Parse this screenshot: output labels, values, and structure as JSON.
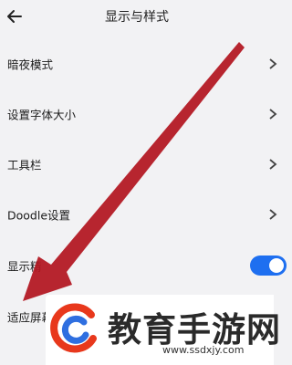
{
  "header": {
    "back_icon": "arrow-left-icon",
    "title": "显示与样式"
  },
  "settings": {
    "items": [
      {
        "label": "暗夜模式",
        "control": "chevron-right-icon"
      },
      {
        "label": "设置字体大小",
        "control": "chevron-right-icon"
      },
      {
        "label": "工具栏",
        "control": "chevron-right-icon"
      },
      {
        "label": "Doodle设置",
        "control": "chevron-right-icon"
      },
      {
        "label": "显示精",
        "control": "toggle",
        "toggle_on": true
      },
      {
        "label": "适应屏幕",
        "control": "none"
      }
    ]
  },
  "annotation": {
    "type": "arrow",
    "color": "#b3161f"
  },
  "watermark": {
    "brand": "教育手游网",
    "url": "www.ssdxjy.com",
    "logo_colors": [
      "#e8381c",
      "#2f6fe0"
    ]
  },
  "colors": {
    "background": "#f2f2f4",
    "toggle_on": "#1e6ff0"
  }
}
